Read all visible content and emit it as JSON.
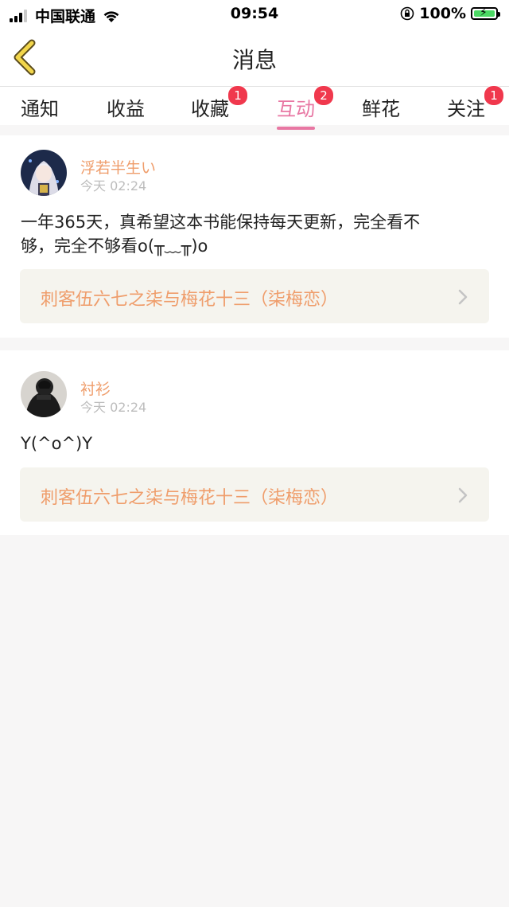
{
  "status_bar": {
    "carrier": "中国联通",
    "time": "09:54",
    "battery": "100%",
    "icons": [
      "signal-icon",
      "wifi-icon",
      "lock-rotation-icon",
      "battery-charging-icon"
    ]
  },
  "nav": {
    "title": "消息",
    "back_icon": "chevron-left-icon",
    "accent": "#e877a3"
  },
  "tabs": [
    {
      "label": "通知",
      "badge": ""
    },
    {
      "label": "收益",
      "badge": ""
    },
    {
      "label": "收藏",
      "badge": "1"
    },
    {
      "label": "互动",
      "badge": "2",
      "active": true
    },
    {
      "label": "鲜花",
      "badge": ""
    },
    {
      "label": "关注",
      "badge": "1"
    }
  ],
  "messages": [
    {
      "username": "浮若半生い",
      "time": "今天 02:24",
      "content_line1": "一年365天，真希望这本书能保持每天更新，完全看不",
      "content_line2": "够，完全不够看o(╥﹏╥)o",
      "book": "刺客伍六七之柒与梅花十三（柒梅恋）"
    },
    {
      "username": "衬衫",
      "time": "今天 02:24",
      "content_line1": "Y(^o^)Y",
      "book": "刺客伍六七之柒与梅花十三（柒梅恋）"
    }
  ],
  "colors": {
    "username": "#ef9d6b",
    "badge": "#f0384d",
    "book_bg": "#f5f4ee"
  }
}
